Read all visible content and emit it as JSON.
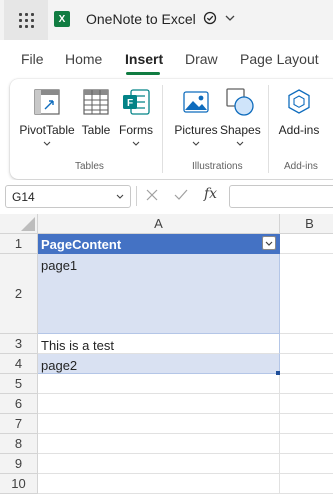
{
  "title_bar": {
    "app_icon": "waffle-icon",
    "excel_logo": "X",
    "doc_title": "OneNote to Excel"
  },
  "tabs": [
    {
      "label": "File"
    },
    {
      "label": "Home"
    },
    {
      "label": "Insert",
      "active": true
    },
    {
      "label": "Draw"
    },
    {
      "label": "Page Layout"
    }
  ],
  "ribbon": {
    "buttons": [
      {
        "label": "PivotTable",
        "icon": "pivot-table-icon"
      },
      {
        "label": "Table",
        "icon": "table-icon"
      },
      {
        "label": "Forms",
        "icon": "forms-icon"
      },
      {
        "label": "Pictures",
        "icon": "pictures-icon"
      },
      {
        "label": "Shapes",
        "icon": "shapes-icon"
      },
      {
        "label": "Add-ins",
        "icon": "add-ins-icon"
      }
    ],
    "groups": [
      "Tables",
      "Illustrations",
      "Add-ins"
    ]
  },
  "formula_bar": {
    "name_box": "G14",
    "fx_label": "fx",
    "value": ""
  },
  "sheet": {
    "columns": [
      "A",
      "B"
    ],
    "rows": [
      "1",
      "2",
      "3",
      "4",
      "5",
      "6",
      "7",
      "8",
      "9",
      "10"
    ],
    "cells": {
      "A1": "PageContent",
      "A2": "page1",
      "A3": "This is a test",
      "A4": "page2"
    }
  },
  "colors": {
    "accent": "#107c41",
    "table_header": "#4472c4",
    "table_band": "#d9e1f2"
  }
}
